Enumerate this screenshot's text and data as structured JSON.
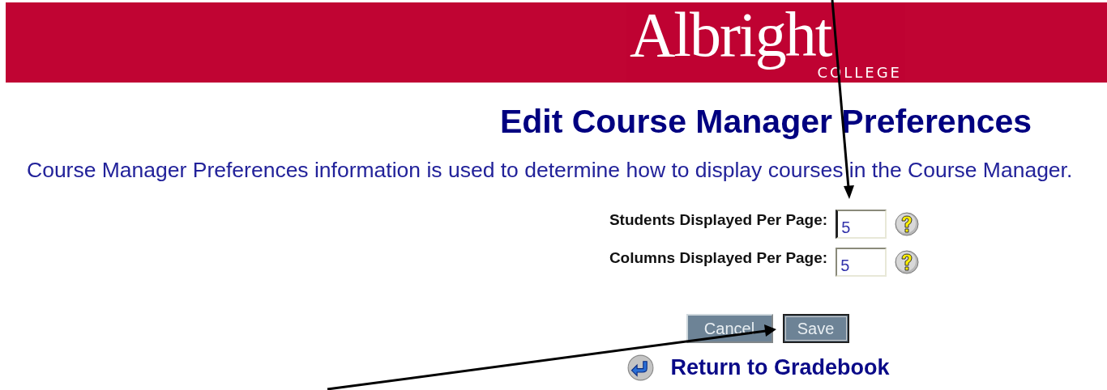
{
  "header": {
    "logo": {
      "name": "Albright",
      "sub": "COLLEGE"
    }
  },
  "title": "Edit Course Manager Preferences",
  "description": "Course Manager Preferences information is used to determine how to display courses in the Course Manager.",
  "fields": [
    {
      "label": "Students Displayed Per Page:",
      "value": "5",
      "focused": true
    },
    {
      "label": "Columns Displayed Per Page:",
      "value": "5",
      "focused": false
    }
  ],
  "buttons": [
    {
      "label": "Cancel",
      "kind": "cancel"
    },
    {
      "label": "Save",
      "kind": "save"
    }
  ],
  "return_link": "Return to Gradebook"
}
